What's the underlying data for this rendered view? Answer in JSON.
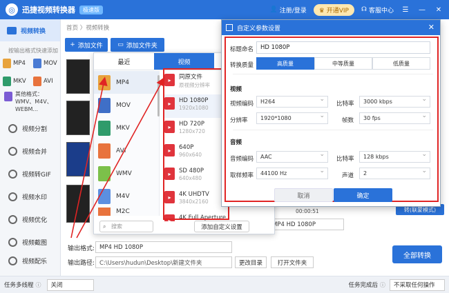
{
  "app": {
    "title": "迅捷视频转换器",
    "badge": "极速版"
  },
  "titlebar": {
    "login": "注册/登录",
    "vip": "开通VIP",
    "service": "客服中心"
  },
  "sidebar": {
    "active": "视频转换",
    "hint": "按输出格式快速添加",
    "formats": [
      "MP4",
      "MOV",
      "MKV",
      "AVI"
    ],
    "other_formats": "其他格式：WMV、M4V、WEBM...",
    "items": [
      "视频分割",
      "视频合并",
      "视频转GIF",
      "视频水印",
      "视频优化",
      "视频截图",
      "视频配乐"
    ]
  },
  "main": {
    "breadcrumb": "首页 〉视频转换",
    "add_file": "添加文件",
    "add_folder": "添加文件夹"
  },
  "popup": {
    "tabs": [
      "最近",
      "视频",
      "音频"
    ],
    "formats": [
      "MP4",
      "MOV",
      "MKV",
      "AVI",
      "WMV",
      "M4V",
      "M2C"
    ],
    "qualities": [
      {
        "name": "同原文件",
        "sub": "原视频分辨率"
      },
      {
        "name": "HD 1080P",
        "sub": "1920x1080"
      },
      {
        "name": "HD 720P",
        "sub": "1280x720"
      },
      {
        "name": "640P",
        "sub": "960x640"
      },
      {
        "name": "SD 480P",
        "sub": "640x480"
      },
      {
        "name": "4K UHDTV",
        "sub": "3840x2160"
      },
      {
        "name": "4K Full Aperture",
        "sub": ""
      }
    ],
    "search_placeholder": "搜索",
    "add_custom": "添加自定义设置"
  },
  "dialog": {
    "title": "自定义参数设置",
    "name_label": "标题命名",
    "name_value": "HD 1080P",
    "quality_label": "转换质量",
    "quality_options": [
      "高质量",
      "中等质量",
      "低质量"
    ],
    "video_section": "视频",
    "video_codec_label": "视频编码",
    "video_codec": "H264",
    "bitrate_label": "比特率",
    "video_bitrate": "3000 kbps",
    "resolution_label": "分辨率",
    "resolution": "1920*1080",
    "fps_label": "帧数",
    "fps": "30 fps",
    "audio_section": "音频",
    "audio_codec_label": "音频编码",
    "audio_codec": "AAC",
    "audio_bitrate_label": "比特率",
    "audio_bitrate": "128 kbps",
    "sample_label": "取样频率",
    "sample_rate": "44100 Hz",
    "channel_label": "声道",
    "channel": "2",
    "cancel": "取消",
    "ok": "确定"
  },
  "behind": {
    "time": "00:00:51",
    "status": "转(联蒙模式)",
    "format_row": "MP4  HD 1080P"
  },
  "output": {
    "format_label": "输出格式:",
    "format_value": "MP4  HD 1080P",
    "path_label": "输出路径:",
    "path_value": "C:\\Users\\hudun\\Desktop\\新建文件夹",
    "change_dir": "更改目录",
    "open_folder": "打开文件夹",
    "convert_all": "全部转换"
  },
  "statusbar": {
    "multitask_label": "任务多线程",
    "multitask_value": "关闭",
    "complete_label": "任务完成后",
    "complete_value": "不采取任何操作"
  },
  "colors": {
    "accent": "#2a72d9",
    "highlight": "#e02424"
  }
}
